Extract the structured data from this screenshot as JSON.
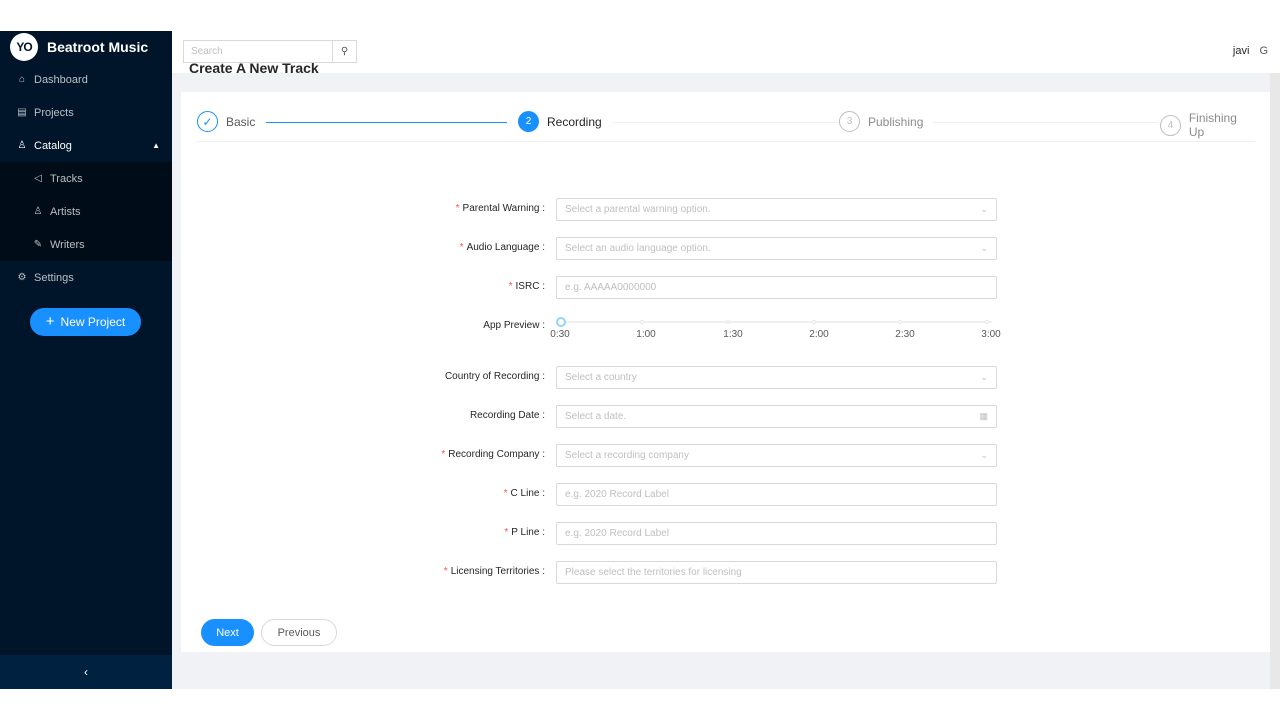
{
  "brand": {
    "name": "Beatroot Music",
    "logo_text": "YO"
  },
  "sidebar": {
    "items": [
      {
        "label": "Dashboard",
        "icon": "home-icon"
      },
      {
        "label": "Projects",
        "icon": "projects-icon"
      },
      {
        "label": "Catalog",
        "icon": "user-icon",
        "expanded": true
      },
      {
        "label": "Settings",
        "icon": "gear-icon"
      }
    ],
    "catalog_sub": [
      {
        "label": "Tracks",
        "icon": "sound-icon"
      },
      {
        "label": "Artists",
        "icon": "user-icon"
      },
      {
        "label": "Writers",
        "icon": "edit-icon"
      }
    ],
    "new_project_label": "New Project"
  },
  "header": {
    "search_placeholder": "Search",
    "username": "javi"
  },
  "page": {
    "title": "Create A New Track"
  },
  "steps": [
    {
      "number": "✓",
      "label": "Basic",
      "status": "finished"
    },
    {
      "number": "2",
      "label": "Recording",
      "status": "active"
    },
    {
      "number": "3",
      "label": "Publishing",
      "status": "wait"
    },
    {
      "number": "4",
      "label": "Finishing Up",
      "status": "wait"
    }
  ],
  "form": {
    "parental_warning": {
      "label": "Parental Warning",
      "placeholder": "Select a parental warning option."
    },
    "audio_language": {
      "label": "Audio Language",
      "placeholder": "Select an audio language option."
    },
    "isrc": {
      "label": "ISRC",
      "placeholder": "e.g. AAAAA0000000"
    },
    "app_preview": {
      "label": "App Preview",
      "marks": [
        "0:30",
        "1:00",
        "1:30",
        "2:00",
        "2:30",
        "3:00"
      ],
      "value": "0:30"
    },
    "country": {
      "label": "Country of Recording",
      "placeholder": "Select a country"
    },
    "recording_date": {
      "label": "Recording Date",
      "placeholder": "Select a date."
    },
    "recording_company": {
      "label": "Recording Company",
      "placeholder": "Select a recording company"
    },
    "c_line": {
      "label": "C Line",
      "placeholder": "e.g. 2020 Record Label"
    },
    "p_line": {
      "label": "P Line",
      "placeholder": "e.g. 2020 Record Label"
    },
    "licensing": {
      "label": "Licensing Territories",
      "placeholder": "Please select the territories for licensing"
    }
  },
  "buttons": {
    "next": "Next",
    "previous": "Previous"
  },
  "colors": {
    "primary": "#1890ff",
    "sidebar": "#001529",
    "required": "#ff4d4f"
  }
}
